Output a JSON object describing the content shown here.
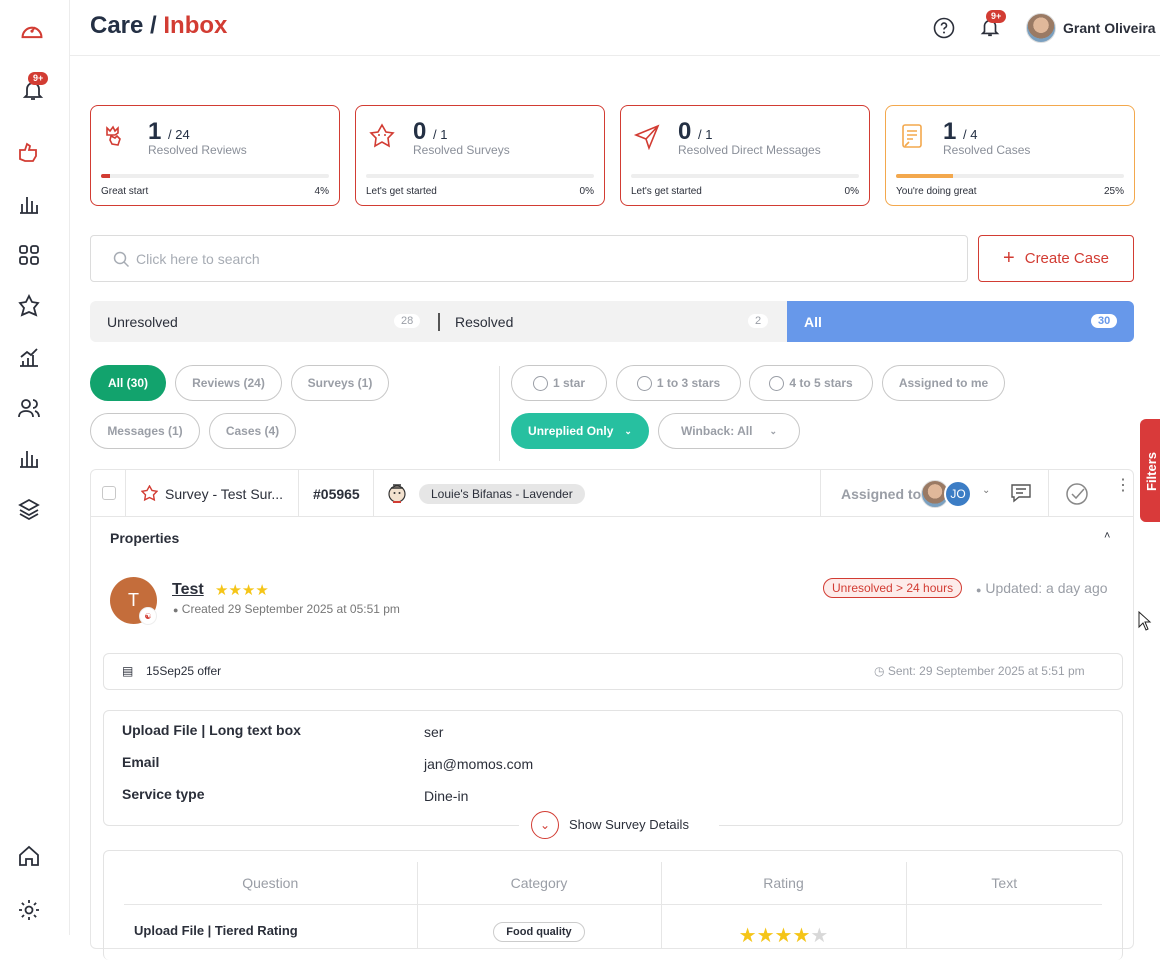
{
  "header": {
    "title_prefix": "Care / ",
    "title_accent": "Inbox",
    "user_name": "Grant Oliveira",
    "notifications_badge": "9+"
  },
  "sidebar": {
    "notifications_badge": "9+"
  },
  "stats": [
    {
      "value": "1",
      "total": "/ 24",
      "label": "Resolved Reviews",
      "footer": "Great start",
      "percent_text": "4%",
      "progress": 0.04
    },
    {
      "value": "0",
      "total": "/ 1",
      "label": "Resolved Surveys",
      "footer": "Let's get started",
      "percent_text": "0%",
      "progress": 0
    },
    {
      "value": "0",
      "total": "/ 1",
      "label": "Resolved Direct Messages",
      "footer": "Let's get started",
      "percent_text": "0%",
      "progress": 0
    },
    {
      "value": "1",
      "total": "/ 4",
      "label": "Resolved Cases",
      "footer": "You're doing great",
      "percent_text": "25%",
      "progress": 0.25
    }
  ],
  "search": {
    "placeholder": "Click here to search"
  },
  "create_case": {
    "label": "Create Case"
  },
  "status_tabs": [
    {
      "label": "Unresolved",
      "count": "28"
    },
    {
      "label": "Resolved",
      "count": "2"
    },
    {
      "label": "All",
      "count": "30"
    }
  ],
  "type_filters": [
    "All (30)",
    "Reviews (24)",
    "Surveys (1)",
    "Messages (1)",
    "Cases (4)"
  ],
  "rating_filters": [
    "1 star",
    "1 to 3 stars",
    "4 to 5 stars",
    "Assigned to me"
  ],
  "unreplied_label": "Unreplied Only",
  "winback_label": "Winback: All",
  "filters_tab": "Filters",
  "item": {
    "type": "Survey - Test Sur...",
    "id": "#05965",
    "location": "Louie's Bifanas - Lavender",
    "assigned_label": "Assigned to",
    "assignee_initials": "JO",
    "properties_label": "Properties",
    "customer_initial": "T",
    "customer_name": "Test",
    "rating": 4,
    "created": "Created 29 September 2025 at 05:51 pm",
    "status_badge": "Unresolved > 24 hours",
    "updated": "Updated: a day ago",
    "offer": "15Sep25 offer",
    "sent": "Sent: 29 September 2025 at 5:51 pm",
    "fields": [
      {
        "key": "Upload File | Long text box",
        "value": "ser"
      },
      {
        "key": "Email",
        "value": "jan@momos.com"
      },
      {
        "key": "Service type",
        "value": "Dine-in"
      }
    ],
    "show_details": "Show Survey Details",
    "table": {
      "headers": [
        "Question",
        "Category",
        "Rating",
        "Text"
      ],
      "rows": [
        {
          "question": "Upload File | Tiered Rating",
          "category": "Food quality",
          "rating": 4
        }
      ]
    }
  }
}
